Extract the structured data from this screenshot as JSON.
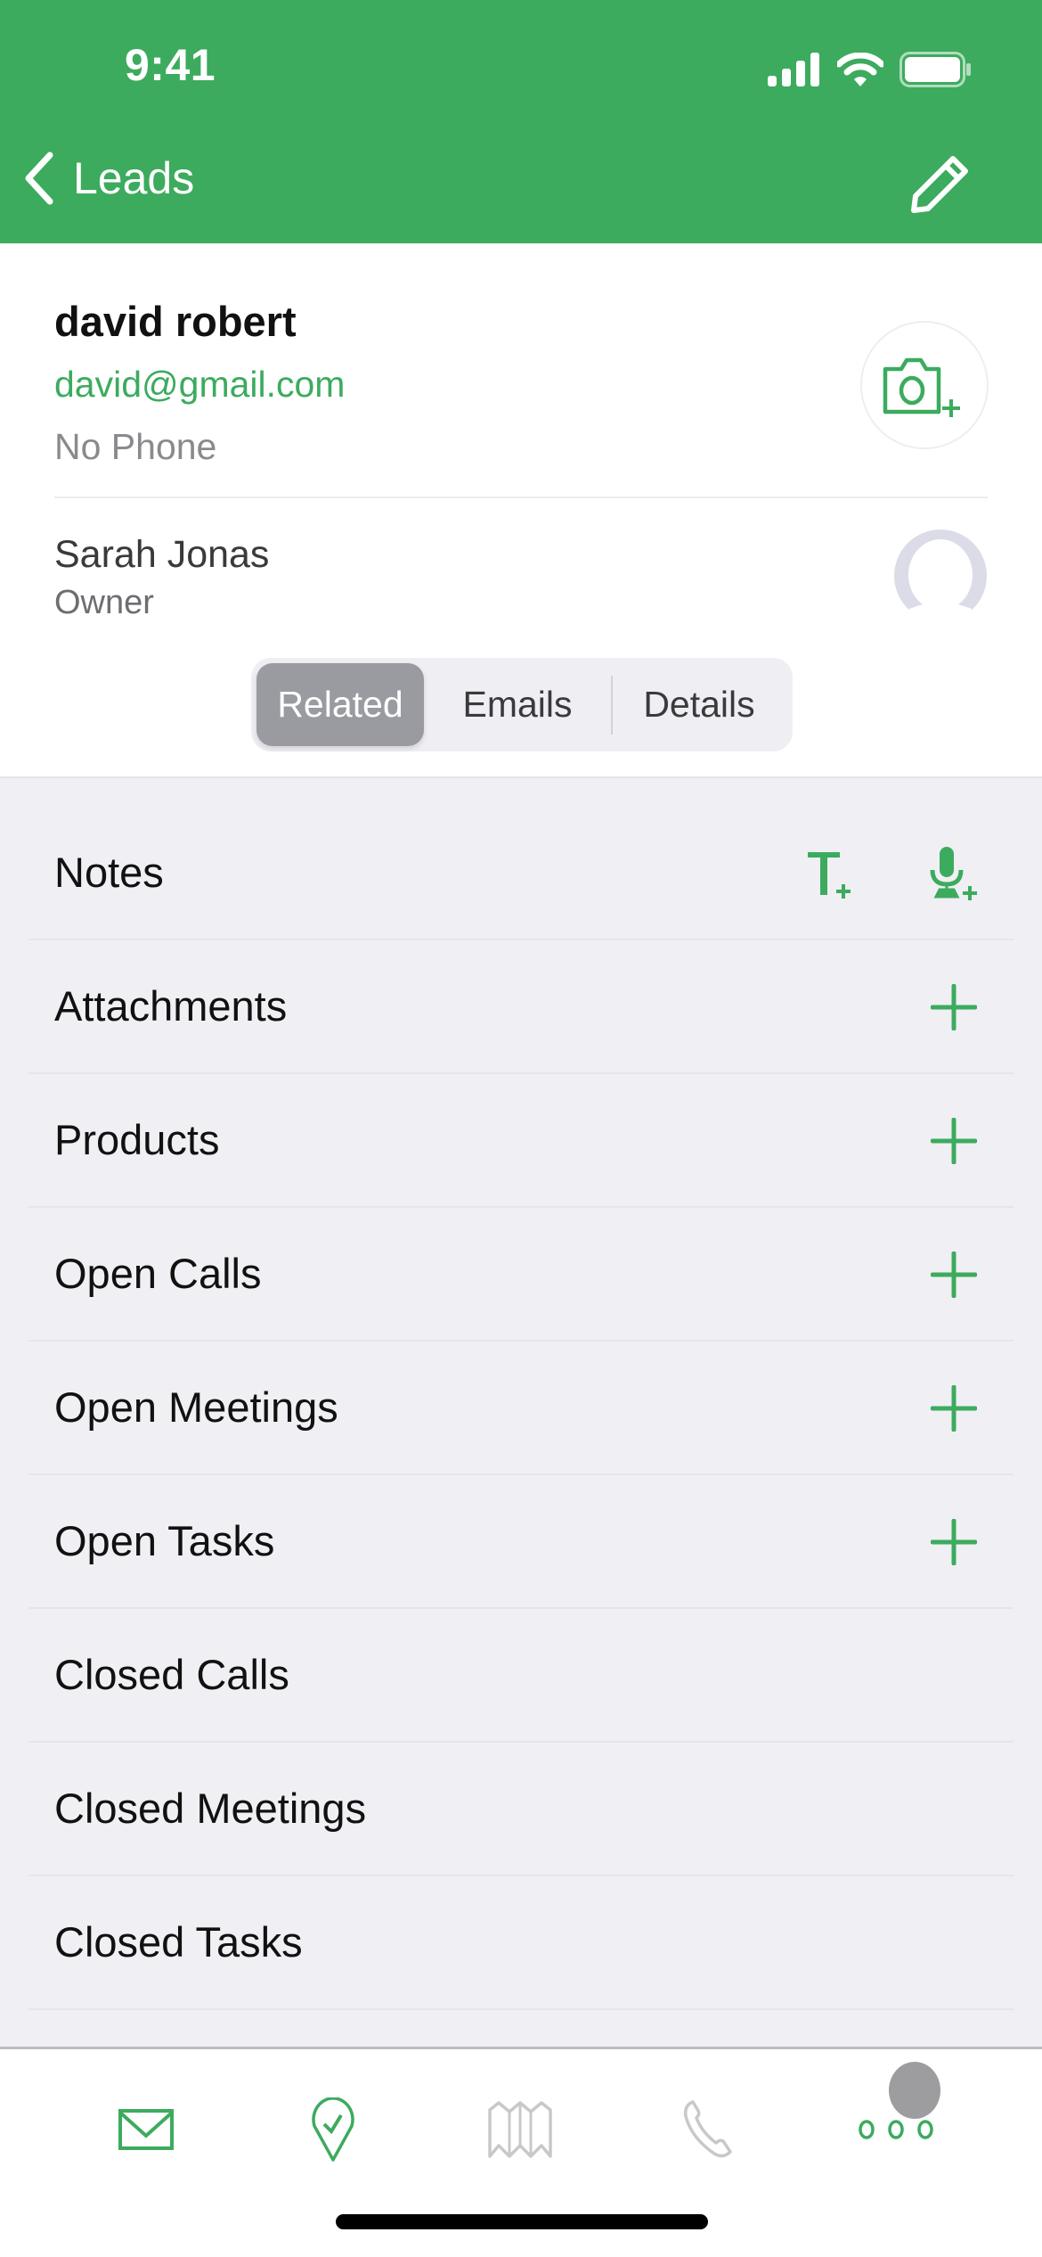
{
  "status_bar": {
    "time": "9:41"
  },
  "nav": {
    "back_label": "Leads",
    "back_icon": "chevron-left-icon",
    "edit_icon": "pencil-icon"
  },
  "lead": {
    "name": "david robert",
    "email": "david@gmail.com",
    "phone": "No Phone",
    "photo_icon": "camera-plus-icon"
  },
  "owner": {
    "name": "Sarah Jonas",
    "role": "Owner"
  },
  "segments": [
    {
      "label": "Related",
      "active": true
    },
    {
      "label": "Emails",
      "active": false
    },
    {
      "label": "Details",
      "active": false
    }
  ],
  "related": [
    {
      "label": "Notes",
      "actions": [
        "text-note-add-icon",
        "voice-note-add-icon"
      ]
    },
    {
      "label": "Attachments",
      "actions": [
        "plus-icon"
      ]
    },
    {
      "label": "Products",
      "actions": [
        "plus-icon"
      ]
    },
    {
      "label": "Open Calls",
      "actions": [
        "plus-icon"
      ]
    },
    {
      "label": "Open Meetings",
      "actions": [
        "plus-icon"
      ]
    },
    {
      "label": "Open Tasks",
      "actions": [
        "plus-icon"
      ]
    },
    {
      "label": "Closed Calls",
      "actions": []
    },
    {
      "label": "Closed Meetings",
      "actions": []
    },
    {
      "label": "Closed Tasks",
      "actions": []
    }
  ],
  "tabbar": [
    {
      "name": "mail",
      "icon": "envelope-icon",
      "color": "#3cab5e"
    },
    {
      "name": "check-in",
      "icon": "location-check-icon",
      "color": "#3cab5e"
    },
    {
      "name": "map",
      "icon": "map-icon",
      "color": "#c8c8c8"
    },
    {
      "name": "phone",
      "icon": "phone-icon",
      "color": "#c8c8c8"
    },
    {
      "name": "more",
      "icon": "more-dots-icon",
      "color": "#3cab5e"
    }
  ],
  "colors": {
    "brand": "#3cab5e",
    "background": "#f0eff4"
  }
}
